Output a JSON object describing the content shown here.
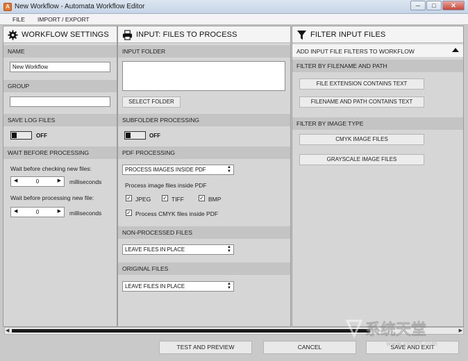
{
  "window": {
    "title": "New Workflow - Automata Workflow Editor",
    "app_icon": "A",
    "controls": [
      "─",
      "□",
      "✕"
    ]
  },
  "menu": {
    "file": "FILE",
    "import_export": "IMPORT / EXPORT"
  },
  "settings": {
    "title": "WORKFLOW SETTINGS",
    "icon": "gear-icon",
    "name_label": "NAME",
    "name_value": "New Workflow",
    "group_label": "GROUP",
    "group_value": "",
    "save_log_label": "SAVE LOG FILES",
    "save_log_state": "OFF",
    "wait_label": "WAIT BEFORE PROCESSING",
    "wait_checking_label": "Wait before checking new files:",
    "wait_checking_value": "0",
    "wait_checking_unit": "milliseconds",
    "wait_processing_label": "Wait before processing new file:",
    "wait_processing_value": "0",
    "wait_processing_unit": "milliseconds"
  },
  "input": {
    "title": "INPUT: FILES TO PROCESS",
    "icon": "printer-icon",
    "folder_label": "INPUT FOLDER",
    "folder_value": "",
    "select_folder": "SELECT FOLDER",
    "subfolder_label": "SUBFOLDER PROCESSING",
    "subfolder_state": "OFF",
    "pdf_label": "PDF PROCESSING",
    "pdf_select": "PROCESS IMAGES INSIDE PDF",
    "pdf_sub_label": "Process image files inside PDF",
    "jpeg": "JPEG",
    "tiff": "TIFF",
    "bmp": "BMP",
    "cmyk": "Process CMYK files inside PDF",
    "nonprocessed_label": "NON-PROCESSED FILES",
    "nonprocessed_select": "LEAVE FILES IN PLACE",
    "original_label": "ORIGINAL FILES",
    "original_select": "LEAVE FILES IN PLACE"
  },
  "filter": {
    "title": "FILTER INPUT FILES",
    "icon": "funnel-icon",
    "add_label": "ADD INPUT FILE FILTERS TO WORKFLOW",
    "by_name_label": "FILTER BY FILENAME AND PATH",
    "ext_button": "FILE EXTENSION CONTAINS TEXT",
    "path_button": "FILENAME AND PATH CONTAINS TEXT",
    "by_type_label": "FILTER BY IMAGE TYPE",
    "cmyk_button": "CMYK IMAGE FILES",
    "gray_button": "GRAYSCALE IMAGE FILES"
  },
  "footer": {
    "test": "TEST AND PREVIEW",
    "cancel": "CANCEL",
    "save": "SAVE AND EXIT"
  },
  "watermark": {
    "cn": "系统天堂",
    "url": "www.xp666.com"
  }
}
